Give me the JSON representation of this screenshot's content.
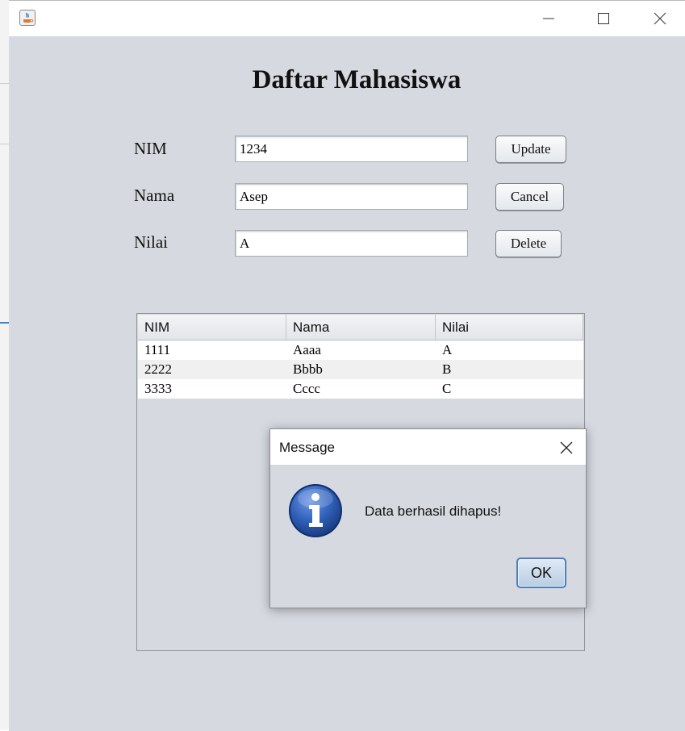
{
  "window": {
    "title": "",
    "icon": "java-icon",
    "controls": [
      "minimize-icon",
      "maximize-icon",
      "close-icon"
    ]
  },
  "page": {
    "title": "Daftar Mahasiswa"
  },
  "form": {
    "fields": [
      {
        "label": "NIM",
        "value": "1234"
      },
      {
        "label": "Nama",
        "value": "Asep"
      },
      {
        "label": "Nilai",
        "value": "A"
      }
    ],
    "buttons": {
      "update": "Update",
      "cancel": "Cancel",
      "delete": "Delete"
    }
  },
  "table": {
    "columns": [
      "NIM",
      "Nama",
      "Nilai"
    ],
    "rows": [
      [
        "1111",
        "Aaaa",
        "A"
      ],
      [
        "2222",
        "Bbbb",
        "B"
      ],
      [
        "3333",
        "Cccc",
        "C"
      ]
    ]
  },
  "dialog": {
    "title": "Message",
    "message": "Data berhasil dihapus!",
    "ok_label": "OK",
    "icon": "info-icon"
  },
  "colors": {
    "window_bg": "#d6d9e0",
    "row_alt": "#f0f0f0",
    "ok_border": "#4e7fb5",
    "info_blue": "#2f5fb8"
  }
}
